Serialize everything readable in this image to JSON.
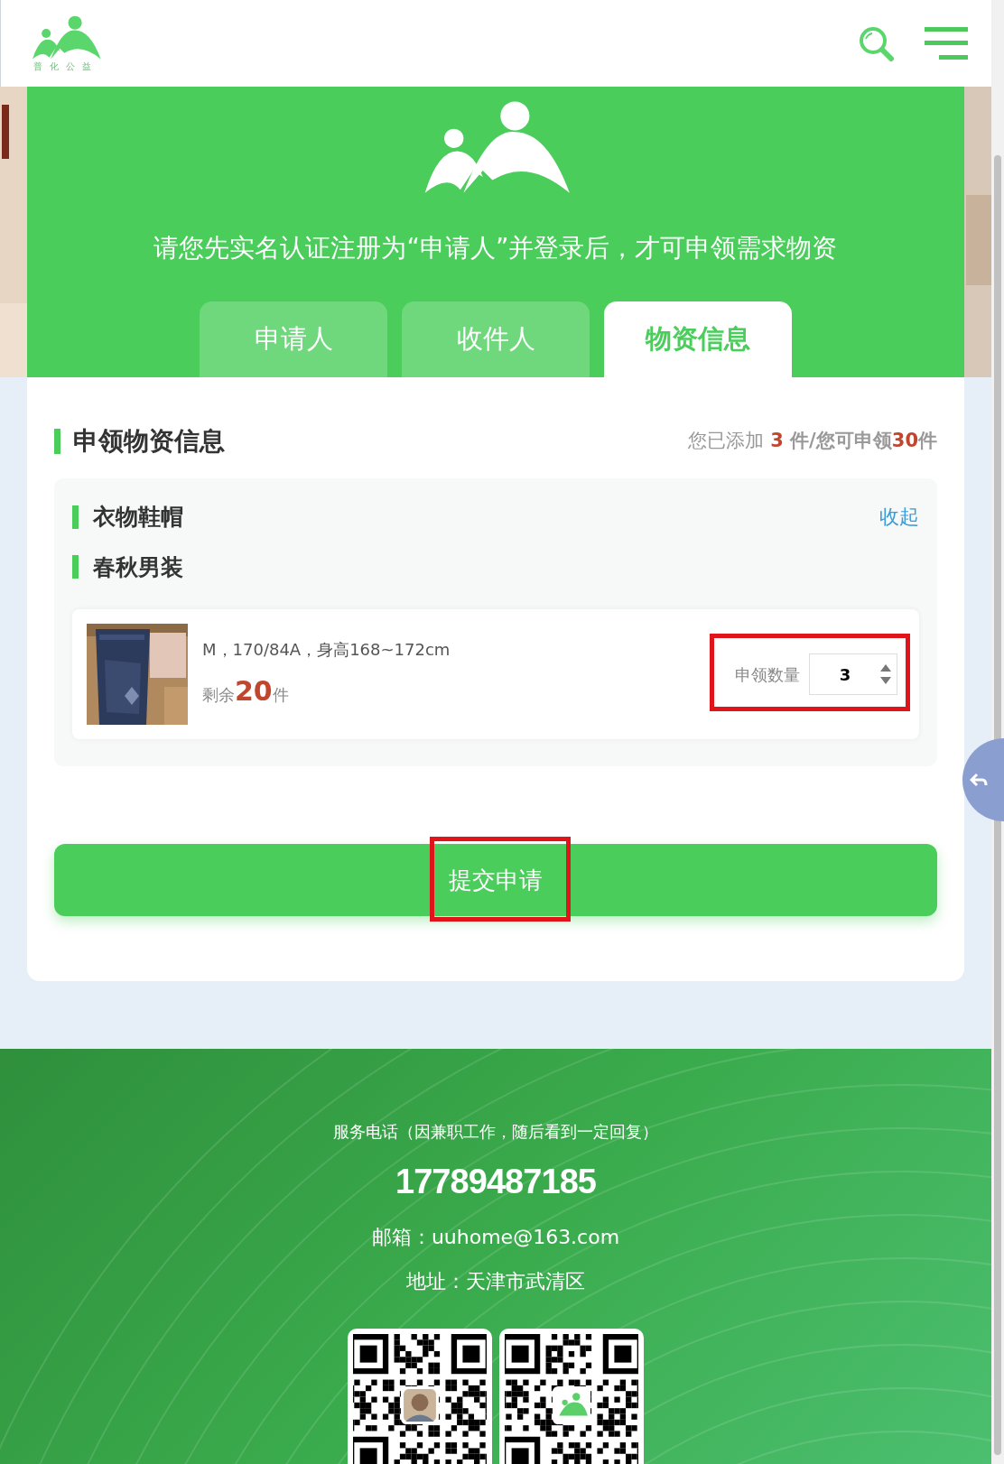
{
  "header": {
    "logo_text": "普化公益"
  },
  "hero": {
    "notice": "请您先实名认证注册为“申请人”并登录后，才可申领需求物资",
    "tabs": [
      {
        "label": "申请人",
        "selected": false
      },
      {
        "label": "收件人",
        "selected": false
      },
      {
        "label": "物资信息",
        "selected": true
      }
    ]
  },
  "section": {
    "title": "申领物资信息",
    "summary": {
      "added_label": "您已添加 ",
      "added_count": "3",
      "limit_label": " 件/您可申领",
      "limit_count": "30",
      "unit": "件"
    }
  },
  "category": {
    "title": "衣物鞋帽",
    "collapse_link": "收起",
    "subcategory": "春秋男装"
  },
  "item": {
    "spec": "M，170/84A，身高168~172cm",
    "remaining_label": "剩余",
    "remaining_count": "20",
    "remaining_unit": "件",
    "quantity_label": "申领数量",
    "quantity": "3"
  },
  "submit_button": "提交申请",
  "footer": {
    "service": "服务电话（因兼职工作，随后看到一定回复）",
    "phone": "17789487185",
    "email": "邮箱：uuhome@163.com",
    "address": "地址：天津市武清区"
  }
}
